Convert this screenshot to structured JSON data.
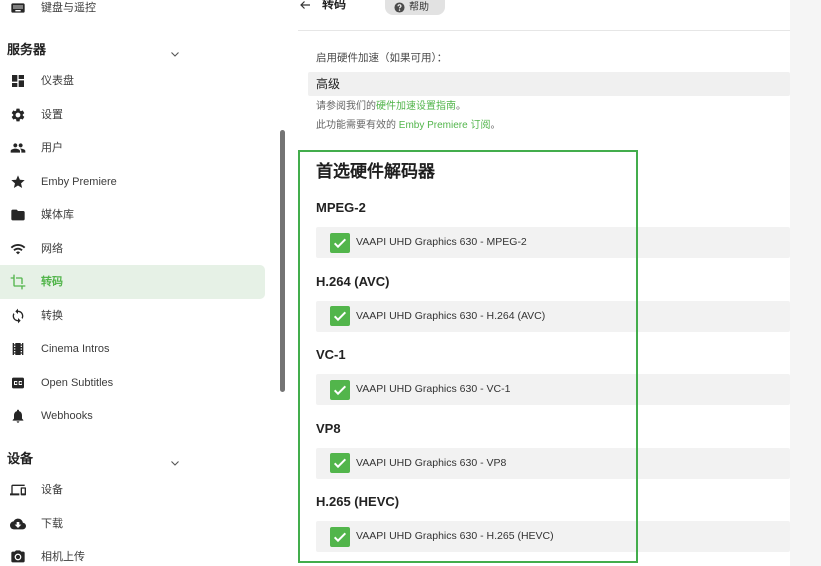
{
  "colors": {
    "accent": "#52b54b",
    "highlight_border": "#43ad4c",
    "active_bg": "#e6f1e6",
    "row_bg": "#f2f2f2",
    "text": "#333333"
  },
  "sidebar": {
    "top_item": {
      "label": "键盘与遥控",
      "icon": "keyboard-icon"
    },
    "server": {
      "title": "服务器",
      "items": [
        {
          "label": "仪表盘",
          "icon": "dashboard-icon"
        },
        {
          "label": "设置",
          "icon": "gear-icon"
        },
        {
          "label": "用户",
          "icon": "users-icon"
        },
        {
          "label": "Emby Premiere",
          "icon": "star-icon"
        },
        {
          "label": "媒体库",
          "icon": "folder-icon"
        },
        {
          "label": "网络",
          "icon": "wifi-icon"
        },
        {
          "label": "转码",
          "icon": "crop-icon",
          "active": true
        },
        {
          "label": "转换",
          "icon": "sync-icon"
        },
        {
          "label": "Cinema Intros",
          "icon": "film-icon"
        },
        {
          "label": "Open Subtitles",
          "icon": "closed-captions-icon"
        },
        {
          "label": "Webhooks",
          "icon": "bell-icon"
        }
      ]
    },
    "devices": {
      "title": "设备",
      "items": [
        {
          "label": "设备",
          "icon": "devices-icon"
        },
        {
          "label": "下载",
          "icon": "cloud-download-icon"
        },
        {
          "label": "相机上传",
          "icon": "camera-icon"
        }
      ]
    }
  },
  "header": {
    "title": "转码",
    "help_label": "帮助",
    "back_icon": "arrow-left-icon",
    "help_icon": "help-circle-icon"
  },
  "hw_accel": {
    "label": "启用硬件加速（如果可用）：",
    "value": "高级",
    "guide_prefix": "请参阅我们的",
    "guide_link": "硬件加速设置指南",
    "guide_suffix": "。",
    "premiere_prefix": "此功能需要有效的 ",
    "premiere_link": "Emby Premiere 订阅",
    "premiere_suffix": "。"
  },
  "decoders": {
    "title": "首选硬件解码器",
    "groups": [
      {
        "codec": "MPEG-2",
        "option": "VAAPI UHD Graphics 630 - MPEG-2",
        "checked": true
      },
      {
        "codec": "H.264 (AVC)",
        "option": "VAAPI UHD Graphics 630 - H.264 (AVC)",
        "checked": true
      },
      {
        "codec": "VC-1",
        "option": "VAAPI UHD Graphics 630 - VC-1",
        "checked": true
      },
      {
        "codec": "VP8",
        "option": "VAAPI UHD Graphics 630 - VP8",
        "checked": true
      },
      {
        "codec": "H.265 (HEVC)",
        "option": "VAAPI UHD Graphics 630 - H.265 (HEVC)",
        "checked": true
      }
    ]
  }
}
